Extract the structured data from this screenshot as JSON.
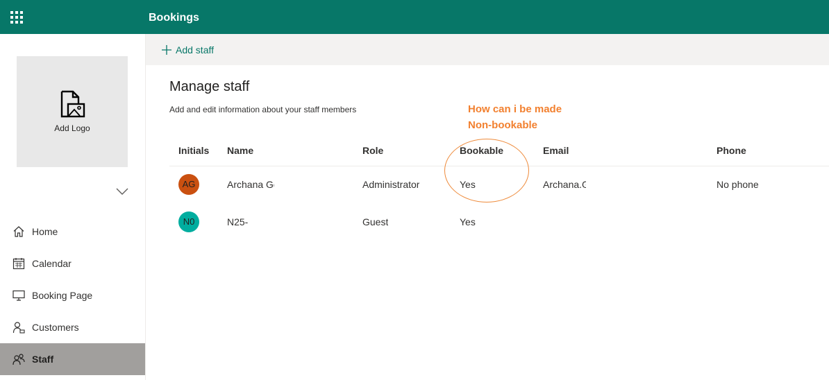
{
  "header": {
    "app_title": "Bookings",
    "app_launcher_icon": "waffle-icon"
  },
  "sidebar": {
    "logo_label": "Add Logo",
    "logo_icon": "image-file-icon",
    "items": [
      {
        "label": "Home",
        "icon": "home-icon"
      },
      {
        "label": "Calendar",
        "icon": "calendar-icon"
      },
      {
        "label": "Booking Page",
        "icon": "monitor-icon"
      },
      {
        "label": "Customers",
        "icon": "customer-icon"
      },
      {
        "label": "Staff",
        "icon": "staff-icon",
        "active": true
      }
    ]
  },
  "commandbar": {
    "add_staff_label": "Add staff"
  },
  "main": {
    "title": "Manage staff",
    "subtitle": "Add and edit information about your staff members",
    "annotation_line1": "How can i be made",
    "annotation_line2": "Non-bookable",
    "columns": [
      "Initials",
      "Name",
      "Role",
      "Bookable",
      "Email",
      "Phone"
    ],
    "rows": [
      {
        "initials": "AG",
        "avatar_color": "#ca5010",
        "name": "Archana Ge",
        "role": "Administrator",
        "bookable": "Yes",
        "email": "Archana.G",
        "phone": "No phone"
      },
      {
        "initials": "N0",
        "avatar_color": "#00ad9f",
        "name": "N25-",
        "role": "Guest",
        "bookable": "Yes",
        "email": "",
        "phone": ""
      }
    ]
  },
  "colors": {
    "header_bg": "#077768",
    "accent": "#077768",
    "annotation": "#f2802f",
    "active_nav_bg": "#a19f9d"
  }
}
